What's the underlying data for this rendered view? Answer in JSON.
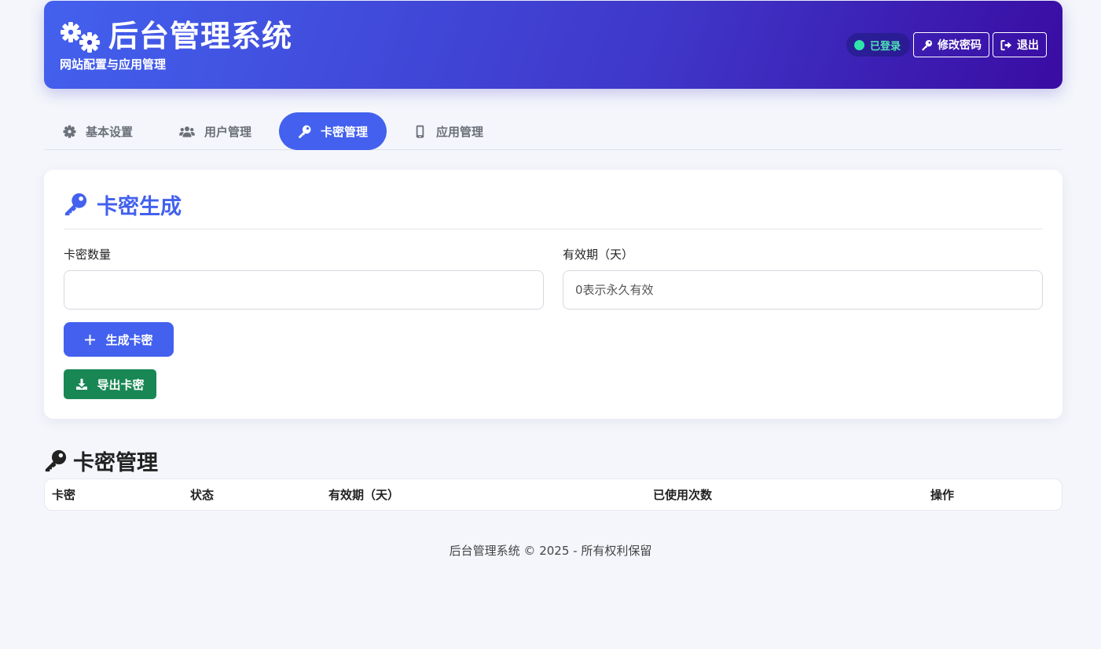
{
  "header": {
    "title": "后台管理系统",
    "subtitle": "网站配置与应用管理",
    "status": "已登录",
    "change_password": "修改密码",
    "logout": "退出"
  },
  "tabs": [
    {
      "label": "基本设置",
      "icon": "gear-icon",
      "active": false
    },
    {
      "label": "用户管理",
      "icon": "users-icon",
      "active": false
    },
    {
      "label": "卡密管理",
      "icon": "key-icon",
      "active": true
    },
    {
      "label": "应用管理",
      "icon": "mobile-icon",
      "active": false
    }
  ],
  "card": {
    "title": "卡密生成",
    "quantity_label": "卡密数量",
    "quantity_value": "",
    "quantity_placeholder": "",
    "validity_label": "有效期（天）",
    "validity_value": "",
    "validity_placeholder": "0表示永久有效",
    "generate_button": "生成卡密",
    "export_button": "导出卡密"
  },
  "section": {
    "title": "卡密管理",
    "columns": [
      "卡密",
      "状态",
      "有效期（天）",
      "已使用次数",
      "操作"
    ],
    "rows": []
  },
  "footer": "后台管理系统 © 2025 - 所有权利保留",
  "colors": {
    "primary": "#4361ee",
    "header_gradient_end": "#3a0ca3",
    "success": "#198754",
    "status_green": "#2ee6a8"
  }
}
